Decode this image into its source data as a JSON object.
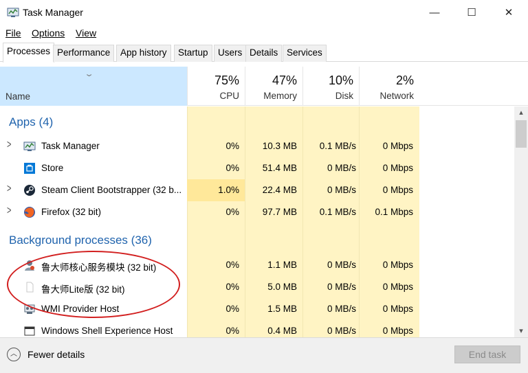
{
  "window": {
    "title": "Task Manager",
    "controls": {
      "minimize": "—",
      "maximize": "☐",
      "close": "✕"
    }
  },
  "menu": [
    "File",
    "Options",
    "View"
  ],
  "tabs": [
    "Processes",
    "Performance",
    "App history",
    "Startup",
    "Users",
    "Details",
    "Services"
  ],
  "columns": {
    "name": "Name",
    "cpu": {
      "pct": "75%",
      "label": "CPU"
    },
    "memory": {
      "pct": "47%",
      "label": "Memory"
    },
    "disk": {
      "pct": "10%",
      "label": "Disk"
    },
    "network": {
      "pct": "2%",
      "label": "Network"
    }
  },
  "groups": {
    "apps": "Apps (4)",
    "background": "Background processes (36)"
  },
  "rows": [
    {
      "name": "Task Manager",
      "icon": "task-manager-icon",
      "expandable": true,
      "cpu": "0%",
      "memory": "10.3 MB",
      "disk": "0.1 MB/s",
      "network": "0 Mbps"
    },
    {
      "name": "Store",
      "icon": "store-icon",
      "expandable": false,
      "cpu": "0%",
      "memory": "51.4 MB",
      "disk": "0 MB/s",
      "network": "0 Mbps"
    },
    {
      "name": "Steam Client Bootstrapper (32 b...",
      "icon": "steam-icon",
      "expandable": true,
      "cpu": "1.0%",
      "memory": "22.4 MB",
      "disk": "0 MB/s",
      "network": "0 Mbps"
    },
    {
      "name": "Firefox (32 bit)",
      "icon": "firefox-icon",
      "expandable": true,
      "cpu": "0%",
      "memory": "97.7 MB",
      "disk": "0.1 MB/s",
      "network": "0.1 Mbps"
    },
    {
      "name": "鲁大师核心服务模块 (32 bit)",
      "icon": "ludashi-service-icon",
      "expandable": false,
      "cpu": "0%",
      "memory": "1.1 MB",
      "disk": "0 MB/s",
      "network": "0 Mbps"
    },
    {
      "name": "鲁大师Lite版 (32 bit)",
      "icon": "ludashi-lite-icon",
      "expandable": false,
      "cpu": "0%",
      "memory": "5.0 MB",
      "disk": "0 MB/s",
      "network": "0 Mbps"
    },
    {
      "name": "WMI Provider Host",
      "icon": "wmi-icon",
      "expandable": false,
      "cpu": "0%",
      "memory": "1.5 MB",
      "disk": "0 MB/s",
      "network": "0 Mbps"
    },
    {
      "name": "Windows Shell Experience Host",
      "icon": "window-icon",
      "expandable": false,
      "cpu": "0%",
      "memory": "0.4 MB",
      "disk": "0 MB/s",
      "network": "0 Mbps"
    }
  ],
  "footer": {
    "fewer_details": "Fewer details",
    "end_task": "End task"
  },
  "colors": {
    "accent": "#1f63ad",
    "header_selected": "#cce8ff",
    "cell_heat": "#fff4c4",
    "annotation": "#d21f1f"
  }
}
